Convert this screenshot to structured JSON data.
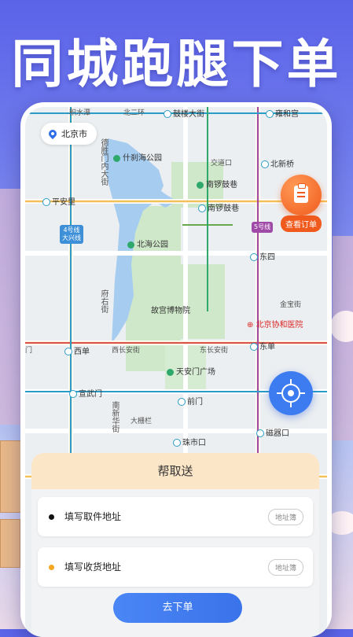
{
  "headline": "同城跑腿下单",
  "city": "北京市",
  "map": {
    "roads": {
      "top_1": "积水潭",
      "top_2": "北二环",
      "top_3": "鼓楼大街",
      "top_4": "雍和宫",
      "jiaodaokou": "交道口",
      "beixinqiao": "北新桥",
      "pinganli": "平安里",
      "nanluoguxiang": "南锣鼓巷",
      "dongsi": "东四",
      "jinbaojie": "金宝街",
      "xidan": "西单",
      "xichang_an": "西长安街",
      "dongchang_an": "东长安街",
      "dongdan": "东单",
      "men": "门",
      "xuanwumen": "宣武门",
      "qianmen": "前门",
      "dashilan": "大栅栏",
      "zhushikou": "珠市口",
      "ciqikou": "磁器口",
      "deshengmen_st": "德胜门内大街",
      "fuyoujie": "府右街",
      "nanxinhua": "新华街",
      "nan": "南"
    },
    "pois": {
      "shichahai": "什刹海公园",
      "nanluogu_poi": "南锣鼓巷",
      "beihai": "北海公园",
      "gugong": "故宫博物院",
      "xiehe": "北京协和医院",
      "tiananmen": "天安门广场"
    },
    "lines": {
      "line4": "4号线\n大兴线",
      "line5": "5号线"
    }
  },
  "order_button": "查看订单",
  "sheet": {
    "title": "帮取送",
    "pickup_placeholder": "填写取件地址",
    "delivery_placeholder": "填写收货地址",
    "address_book": "地址簿",
    "submit": "去下单"
  },
  "colors": {
    "accent_blue": "#3d7cf0",
    "accent_orange": "#f05a1c",
    "pickup_dot": "#111111",
    "delivery_dot": "#f5a623",
    "sheet_header": "#fbe6c8"
  },
  "icons": {
    "location": "pin-icon",
    "order": "clipboard-icon",
    "locate": "crosshair-icon"
  }
}
